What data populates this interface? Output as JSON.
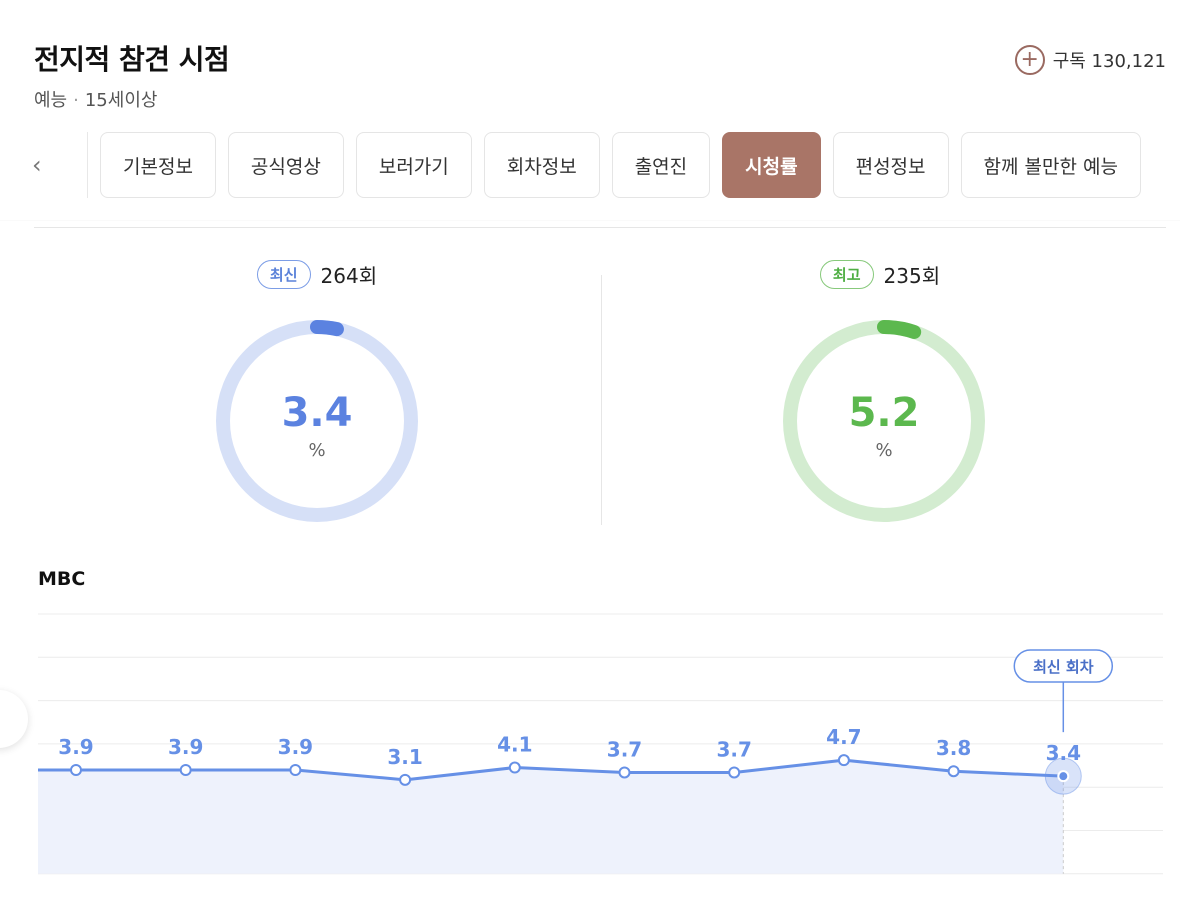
{
  "header": {
    "title": "전지적 참견 시점",
    "genre": "예능",
    "separator": "·",
    "rating": "15세이상",
    "subscribe_label": "구독 130,121"
  },
  "tabs": [
    {
      "label": "기본정보",
      "active": false
    },
    {
      "label": "공식영상",
      "active": false
    },
    {
      "label": "보러가기",
      "active": false
    },
    {
      "label": "회차정보",
      "active": false
    },
    {
      "label": "출연진",
      "active": false
    },
    {
      "label": "시청률",
      "active": true
    },
    {
      "label": "편성정보",
      "active": false
    },
    {
      "label": "함께 볼만한 예능",
      "active": false
    }
  ],
  "latest": {
    "badge": "최신",
    "episode": "264회",
    "value": "3.4",
    "unit": "%",
    "fraction": 0.034,
    "color": "#5b82e0",
    "track": "#d6e0f7"
  },
  "best": {
    "badge": "최고",
    "episode": "235회",
    "value": "5.2",
    "unit": "%",
    "fraction": 0.052,
    "color": "#5cb84e",
    "track": "#d3ecd0"
  },
  "chart_data": {
    "type": "line",
    "title": "MBC",
    "values": [
      3.9,
      3.9,
      3.9,
      3.1,
      4.1,
      3.7,
      3.7,
      4.7,
      3.8,
      3.4
    ],
    "value_labels": [
      "3.9",
      "3.9",
      "3.9",
      "3.1",
      "4.1",
      "3.7",
      "3.7",
      "4.7",
      "3.8",
      "3.4"
    ],
    "annotation": "최신 회차",
    "grid": true,
    "line_color": "#6690e6",
    "fill_color": "#eef2fc"
  }
}
